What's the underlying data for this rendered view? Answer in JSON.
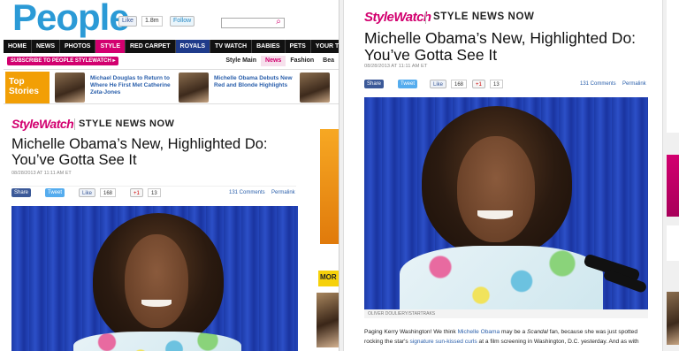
{
  "left": {
    "logo": "People",
    "social": {
      "like": "Like",
      "like_count": "1.8m",
      "follow": "Follow"
    },
    "nav": [
      "HOME",
      "NEWS",
      "PHOTOS",
      "STYLE",
      "RED CARPET",
      "ROYALS",
      "TV WATCH",
      "BABIES",
      "PETS",
      "YOUR TURN"
    ],
    "subscribe": "SUBSCRIBE TO PEOPLE STYLEWATCH ▸",
    "subnav": [
      "Style Main",
      "News",
      "Fashion",
      "Bea"
    ],
    "top_stories": {
      "label": "Top Stories",
      "items": [
        "Michael Douglas to Return to Where He First Met Catherine Zeta-Jones",
        "Michelle Obama Debuts New Red and Blonde Highlights"
      ]
    },
    "more_label": "MOR"
  },
  "article": {
    "brand": "StyleWatch",
    "section": "STYLE NEWS NOW",
    "headline": "Michelle Obama’s New, Highlighted Do: You’ve Gotta See It",
    "date": "08/28/2013 AT 11:11 AM ET",
    "share": {
      "share_label": "Share",
      "tweet_label": "Tweet",
      "like_label": "Like",
      "like_count": "168",
      "gplus_label": "+1",
      "gplus_count": "13",
      "comments": "131 Comments",
      "permalink": "Permalink"
    },
    "photo_credit": "OLIVER DOULIERY/STARTRAKS",
    "body": {
      "t1": "Paging Kerry Washington! We think ",
      "link1": "Michelle Obama",
      "t2": " may be a ",
      "em1": "Scandal",
      "t3": " fan, because she was just spotted rocking the star's ",
      "link2": "signature sun-kissed curls",
      "t4": " at a film screening in Washington, D.C. yesterday. And as with"
    }
  },
  "colors": {
    "brand_pink": "#d2006f",
    "people_blue": "#2b9ad6",
    "link_blue": "#2a5fab"
  }
}
